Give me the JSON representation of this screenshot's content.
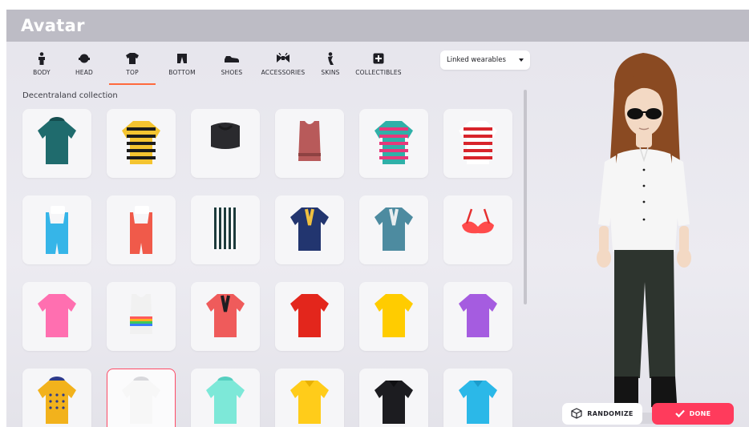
{
  "window": {
    "title": "Avatar"
  },
  "tabs": [
    {
      "id": "body",
      "label": "BODY",
      "icon": "body-icon",
      "active": false
    },
    {
      "id": "head",
      "label": "HEAD",
      "icon": "head-icon",
      "active": false
    },
    {
      "id": "top",
      "label": "TOP",
      "icon": "shirt-icon",
      "active": true
    },
    {
      "id": "bottom",
      "label": "BOTTOM",
      "icon": "pants-icon",
      "active": false
    },
    {
      "id": "shoes",
      "label": "SHOES",
      "icon": "shoe-icon",
      "active": false
    },
    {
      "id": "accessories",
      "label": "ACCESSORIES",
      "icon": "bow-icon",
      "active": false
    },
    {
      "id": "skins",
      "label": "SKINS",
      "icon": "skin-icon",
      "active": false
    },
    {
      "id": "collectibles",
      "label": "COLLECTIBLES",
      "icon": "collectible-icon",
      "active": false
    }
  ],
  "filter": {
    "selected": "Linked wearables"
  },
  "collection": {
    "title": "Decentraland collection",
    "items": [
      {
        "kind": "hoodie",
        "primary": "#1f6b6d",
        "secondary": "#154e50"
      },
      {
        "kind": "tee-stripes",
        "primary": "#f4c430",
        "secondary": "#1b1b1b"
      },
      {
        "kind": "crop",
        "primary": "#2a2a2e",
        "secondary": "#1a1a1c"
      },
      {
        "kind": "tank",
        "primary": "#b85a5a",
        "secondary": "#8e4242"
      },
      {
        "kind": "sweater-stripes",
        "primary": "#2fb0a8",
        "secondary": "#e8387a"
      },
      {
        "kind": "shirt-stripes",
        "primary": "#ffffff",
        "secondary": "#d8242b"
      },
      {
        "kind": "overalls",
        "primary": "#36b5e8",
        "secondary": "#ffffff"
      },
      {
        "kind": "overalls",
        "primary": "#f05a4a",
        "secondary": "#ffffff"
      },
      {
        "kind": "vest-stripes",
        "primary": "#1d3b3c",
        "secondary": "#ffffff"
      },
      {
        "kind": "jacket",
        "primary": "#22356f",
        "secondary": "#f0c040"
      },
      {
        "kind": "jacket",
        "primary": "#4d8ba0",
        "secondary": "#e9eef0"
      },
      {
        "kind": "bikini",
        "primary": "#ff4b4b",
        "secondary": "#e63030"
      },
      {
        "kind": "tee",
        "primary": "#ff6fb0",
        "secondary": "#e8559a"
      },
      {
        "kind": "tank-rainbow",
        "primary": "#f1f1f1",
        "secondary": "#ff5a5a"
      },
      {
        "kind": "jacket",
        "primary": "#ef5b5b",
        "secondary": "#1e1e22"
      },
      {
        "kind": "tee",
        "primary": "#e3261c",
        "secondary": "#b81c14"
      },
      {
        "kind": "tee",
        "primary": "#ffcc00",
        "secondary": "#f0b800"
      },
      {
        "kind": "tee",
        "primary": "#a55ce0",
        "secondary": "#8244c4"
      },
      {
        "kind": "hoodie-dots",
        "primary": "#f2b21c",
        "secondary": "#2e3a8a"
      },
      {
        "kind": "hoodie",
        "primary": "#f7f7f7",
        "secondary": "#d8d8dc"
      },
      {
        "kind": "hoodie",
        "primary": "#7de8d8",
        "secondary": "#56cfc0"
      },
      {
        "kind": "polo",
        "primary": "#ffcc1a",
        "secondary": "#e8b000"
      },
      {
        "kind": "polo",
        "primary": "#1c1c20",
        "secondary": "#0f0f12"
      },
      {
        "kind": "polo",
        "primary": "#2bb8e8",
        "secondary": "#1c9ccc"
      }
    ],
    "selected_index": 19
  },
  "avatar": {
    "hair": "#8a4a22",
    "skin": "#f3d9c4",
    "shirt": "#f6f6f6",
    "pants": "#2d342e",
    "shoes": "#141414",
    "glasses": "#101010"
  },
  "actions": {
    "randomize_label": "RANDOMIZE",
    "randomize_icon": "dice-icon",
    "done_label": "DONE",
    "done_icon": "check-icon"
  }
}
